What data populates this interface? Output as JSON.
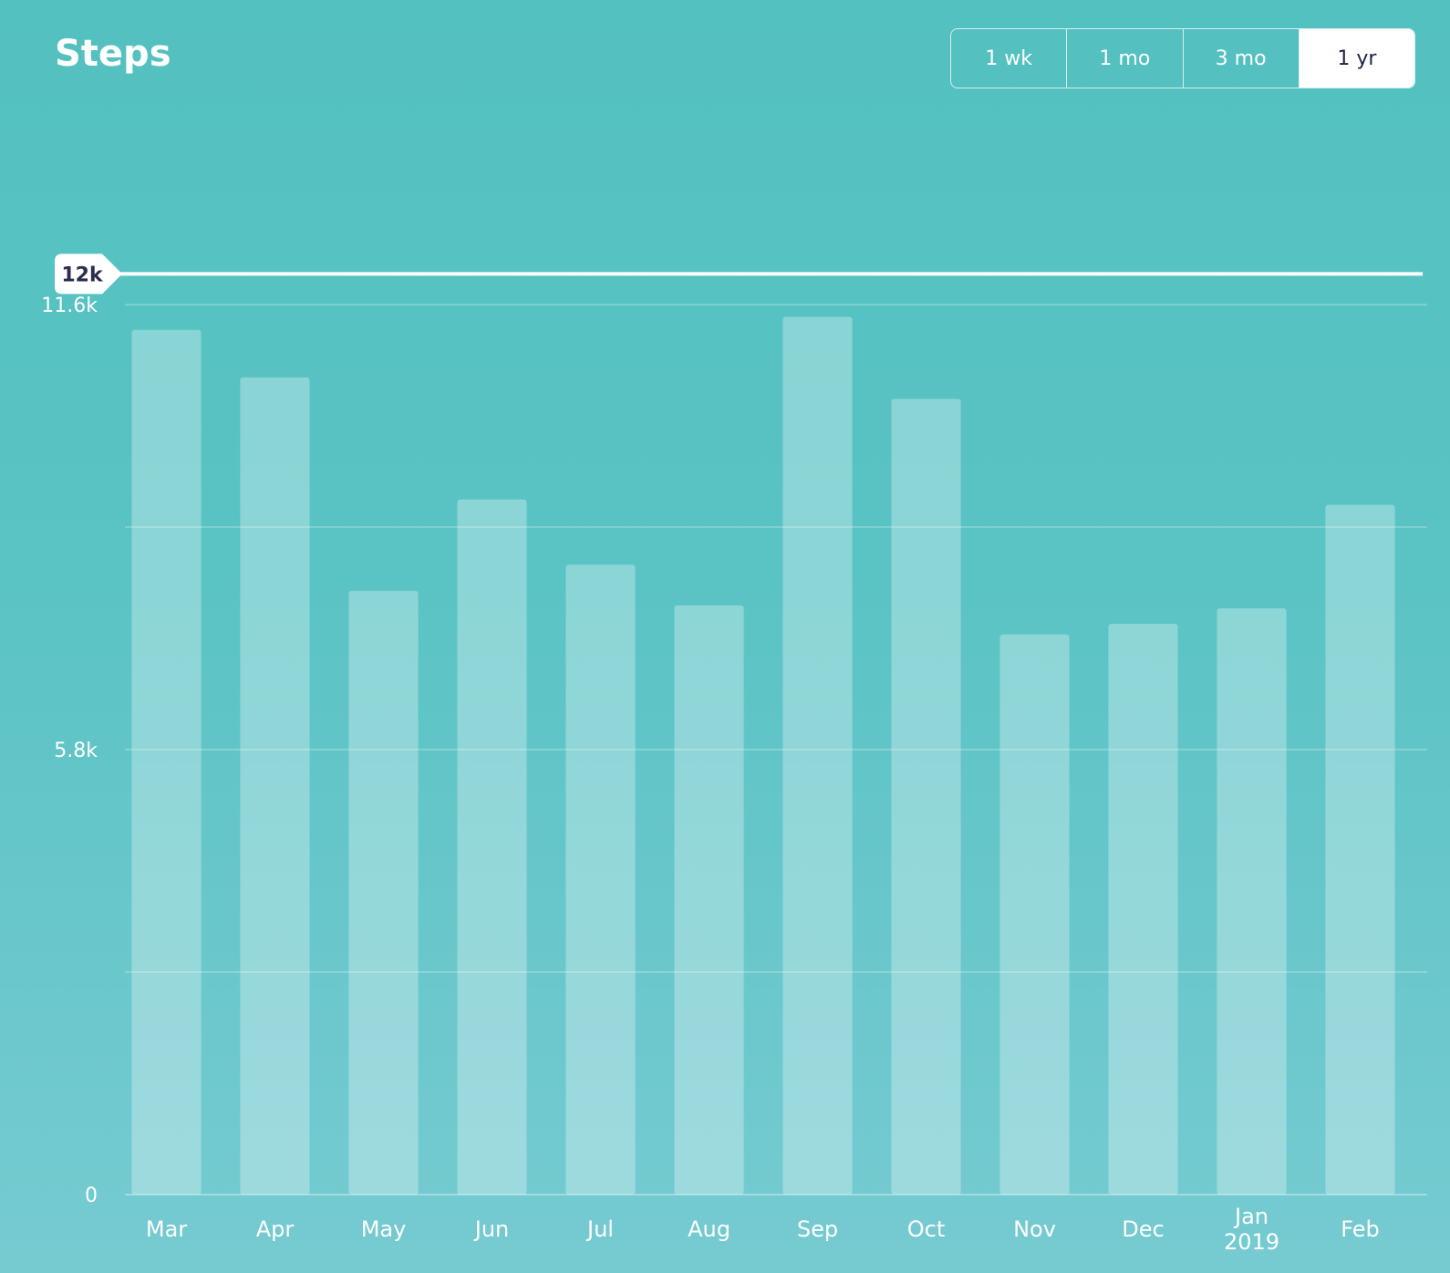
{
  "header": {
    "title": "Steps",
    "ranges": [
      {
        "label": "1 wk",
        "active": false
      },
      {
        "label": "1 mo",
        "active": false
      },
      {
        "label": "3 mo",
        "active": false
      },
      {
        "label": "1 yr",
        "active": true
      }
    ]
  },
  "colors": {
    "background_top": "#53c1c0",
    "background_bottom": "#76cbd1",
    "bar": "#ffffff",
    "goal_line": "#ffffff",
    "goal_text": "#2a2e4e"
  },
  "chart_data": {
    "type": "bar",
    "title": "Steps",
    "categories": [
      "Mar",
      "Apr",
      "May",
      "Jun",
      "Jul",
      "Aug",
      "Sep",
      "Oct",
      "Nov",
      "Dec",
      "Jan",
      "Feb"
    ],
    "category_sublabels": [
      "",
      "",
      "",
      "",
      "",
      "",
      "",
      "",
      "",
      "",
      "2019",
      ""
    ],
    "values": [
      11270,
      10650,
      7870,
      9060,
      8210,
      7680,
      11440,
      10370,
      7300,
      7440,
      7640,
      8990
    ],
    "yticks": [
      "0",
      "5.8k",
      "11.6k"
    ],
    "ytick_values": [
      0,
      5800,
      11600
    ],
    "ylim": [
      0,
      11600
    ],
    "grid": true,
    "goal": {
      "label": "12k",
      "value": 12000
    }
  }
}
